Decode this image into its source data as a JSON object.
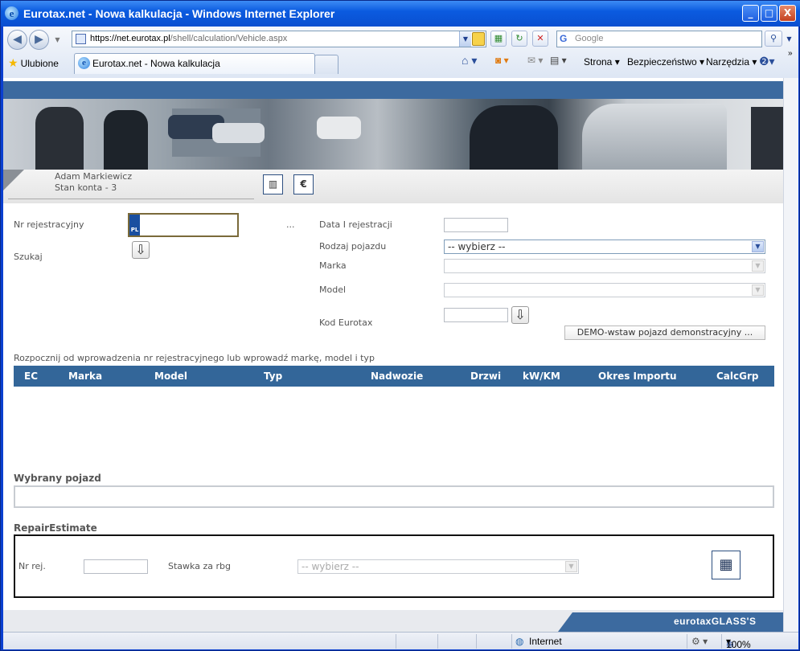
{
  "window": {
    "title": "Eurotax.net - Nowa kalkulacja - Windows Internet Explorer",
    "controls": [
      "_",
      "□",
      "X"
    ]
  },
  "browser": {
    "address_host": "https://net.eurotax.pl",
    "address_path": "/shell/calculation/Vehicle.aspx",
    "search_placeholder": "Google",
    "favorites_label": "Ulubione",
    "tab_title": "Eurotax.net - Nowa kalkulacja",
    "menu": {
      "page": "Strona",
      "safety": "Bezpieczeństwo",
      "tools": "Narzędzia"
    }
  },
  "user": {
    "name": "Adam Markiewicz",
    "account": "Stan konta - 3"
  },
  "form": {
    "reg_label": "Nr rejestracyjny",
    "plate_country": "PL",
    "search_label": "Szukaj",
    "ellipsis": "...",
    "first_reg_label": "Data I rejestracji",
    "vehicle_type_label": "Rodzaj pojazdu",
    "vehicle_type_value": "-- wybierz --",
    "make_label": "Marka",
    "model_label": "Model",
    "eurotax_code_label": "Kod Eurotax",
    "demo_button": "DEMO-wstaw pojazd demonstracyjny ..."
  },
  "hint": "Rozpocznij od wprowadzenia nr rejestracyjnego lub wprowadź markę, model i typ",
  "grid": {
    "columns": [
      "EC",
      "Marka",
      "Model",
      "Typ",
      "Nadwozie",
      "Drzwi",
      "kW/KM",
      "Okres Importu",
      "CalcGrp"
    ]
  },
  "selected": {
    "title": "Wybrany pojazd"
  },
  "repair": {
    "title": "RepairEstimate",
    "reg_label": "Nr rej.",
    "rate_label": "Stawka za rbg",
    "rate_value": "-- wybierz --"
  },
  "footer": {
    "brand": "eurotaxGLASS'S"
  },
  "status": {
    "zone": "Internet",
    "zoom": "100%"
  }
}
